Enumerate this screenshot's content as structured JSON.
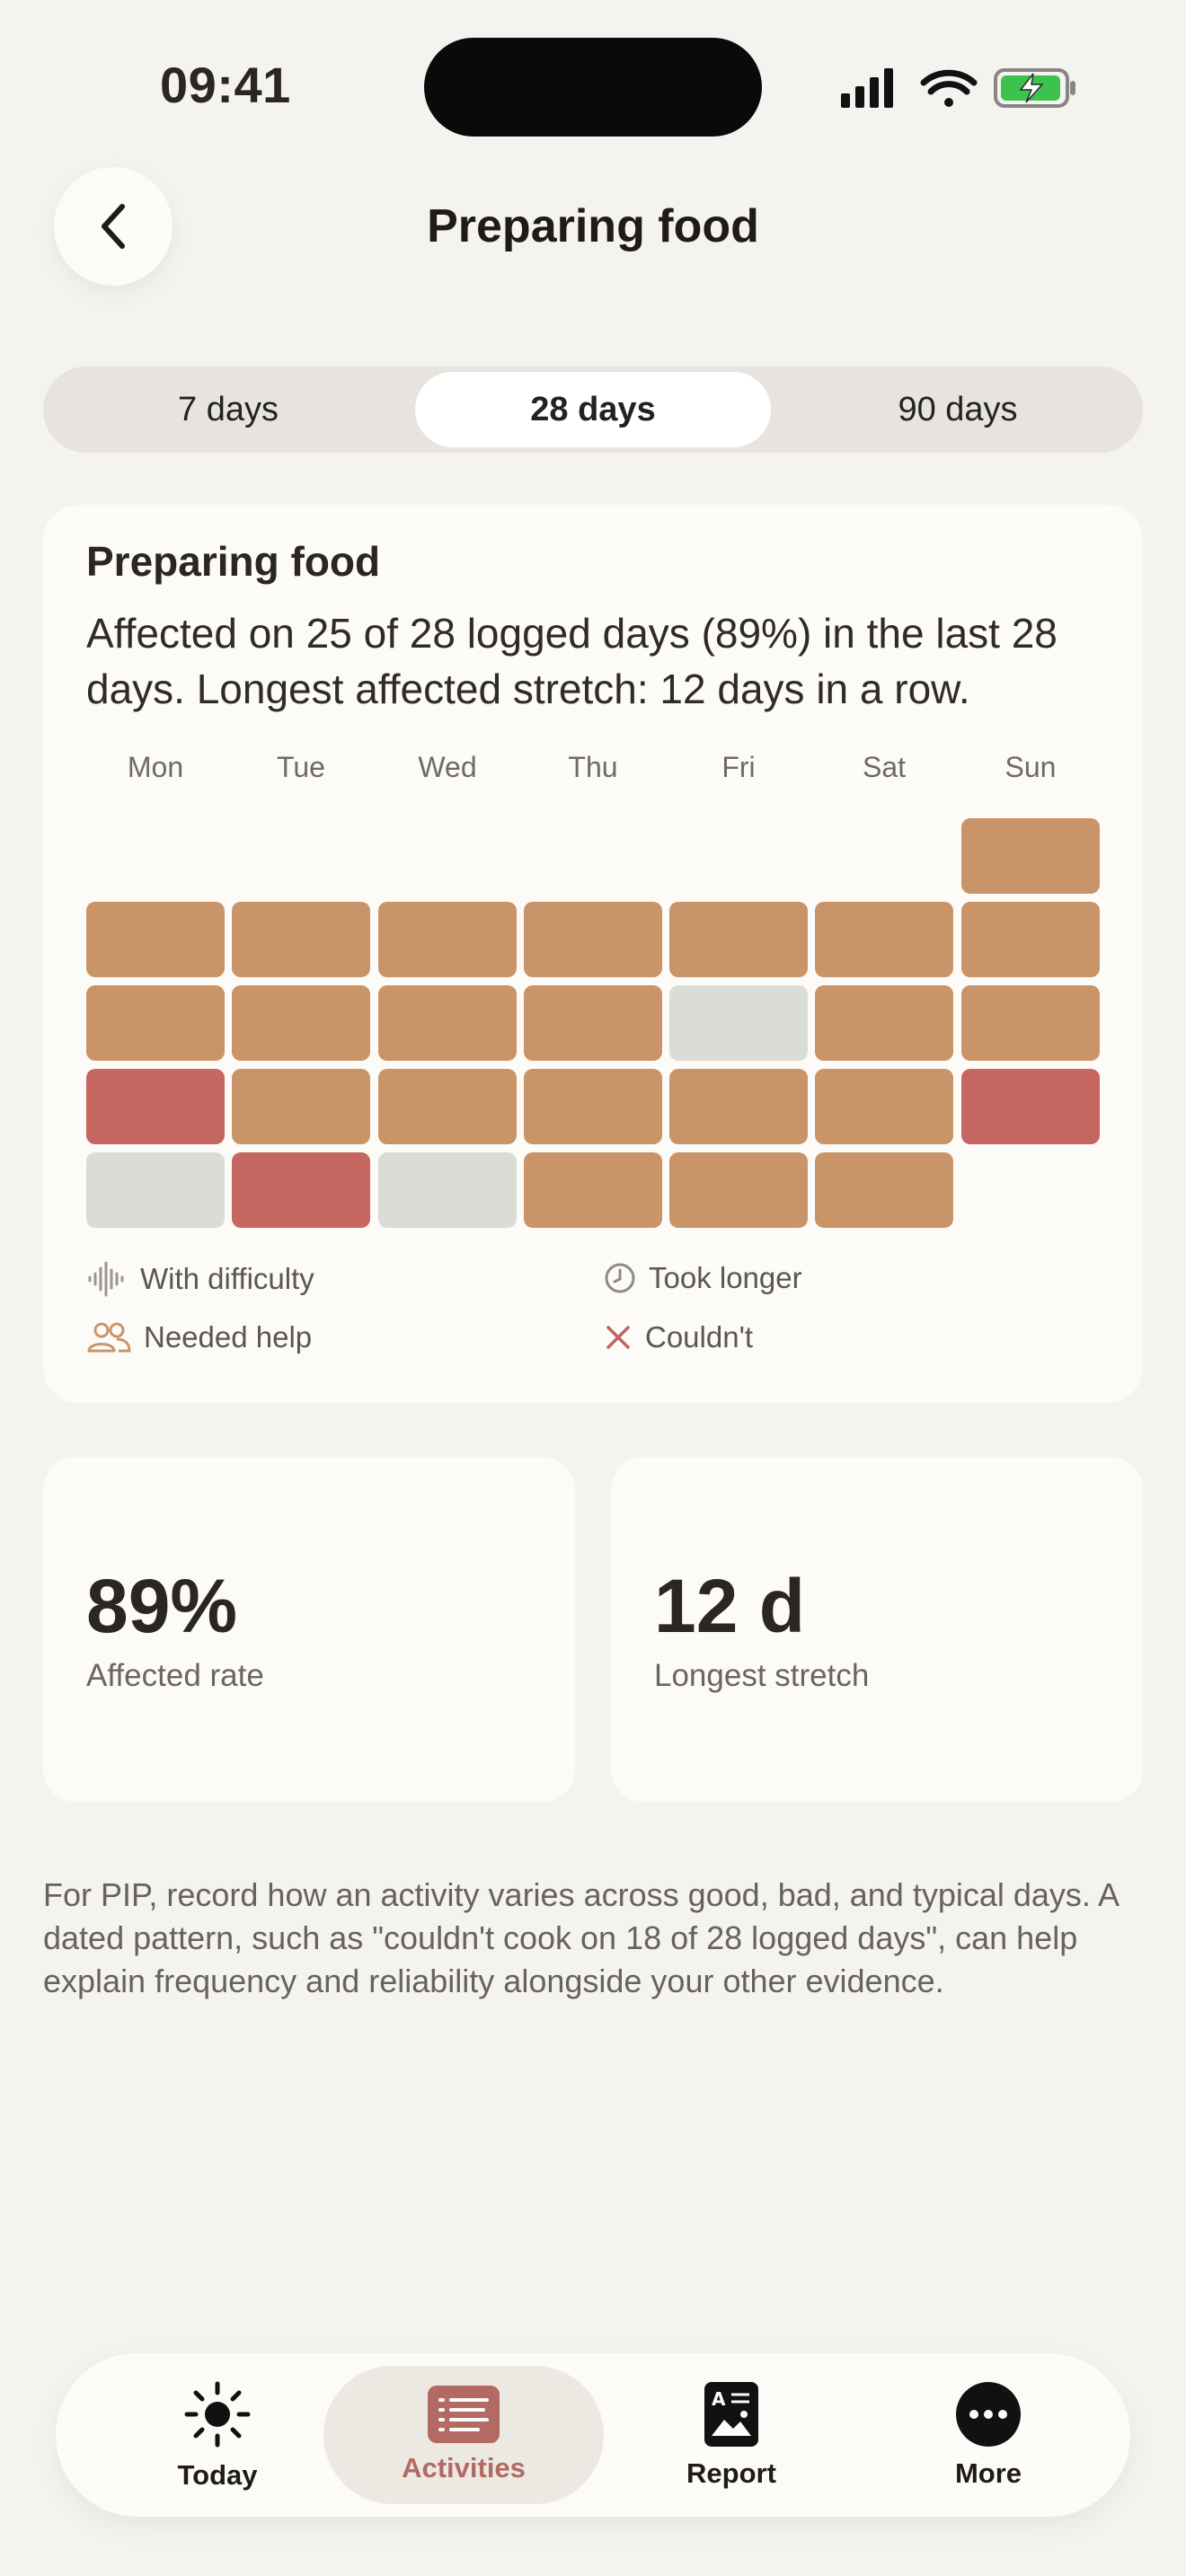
{
  "status_bar": {
    "time": "09:41"
  },
  "header": {
    "title": "Preparing food"
  },
  "range_tabs": [
    {
      "label": "7 days",
      "active": false
    },
    {
      "label": "28 days",
      "active": true
    },
    {
      "label": "90 days",
      "active": false
    }
  ],
  "summary_card": {
    "title": "Preparing food",
    "description": "Affected on 25 of 28 logged days (89%) in the last 28 days. Longest affected stretch: 12 days in a row.",
    "weekdays": [
      "Mon",
      "Tue",
      "Wed",
      "Thu",
      "Fri",
      "Sat",
      "Sun"
    ],
    "calendar": [
      [
        null,
        null,
        null,
        null,
        null,
        null,
        "took-longer"
      ],
      [
        "took-longer",
        "took-longer",
        "took-longer",
        "took-longer",
        "took-longer",
        "took-longer",
        "took-longer"
      ],
      [
        "took-longer",
        "took-longer",
        "took-longer",
        "took-longer",
        "unaffected",
        "took-longer",
        "took-longer"
      ],
      [
        "couldnt",
        "took-longer",
        "took-longer",
        "took-longer",
        "took-longer",
        "took-longer",
        "couldnt"
      ],
      [
        "unaffected",
        "couldnt",
        "unaffected",
        "took-longer",
        "took-longer",
        "took-longer",
        null
      ]
    ],
    "colors": {
      "took-longer": "#C89468",
      "couldnt": "#C66660",
      "unaffected": "#D9DDD6"
    },
    "legend": [
      {
        "label": "With difficulty",
        "icon": "waveform-icon"
      },
      {
        "label": "Took longer",
        "icon": "clock-icon"
      },
      {
        "label": "Needed help",
        "icon": "people-icon"
      },
      {
        "label": "Couldn't",
        "icon": "x-icon"
      }
    ]
  },
  "stats": [
    {
      "value": "89%",
      "label": "Affected rate"
    },
    {
      "value": "12 d",
      "label": "Longest stretch"
    }
  ],
  "note": "For PIP, record how an activity varies across good, bad, and typical days. A dated pattern, such as \"couldn't cook on 18 of 28 logged days\", can help explain frequency and reliability alongside your other evidence.",
  "tab_bar": [
    {
      "label": "Today",
      "icon": "sun-icon",
      "active": false
    },
    {
      "label": "Activities",
      "icon": "list-icon",
      "active": true
    },
    {
      "label": "Report",
      "icon": "document-icon",
      "active": false
    },
    {
      "label": "More",
      "icon": "more-icon",
      "active": false
    }
  ]
}
